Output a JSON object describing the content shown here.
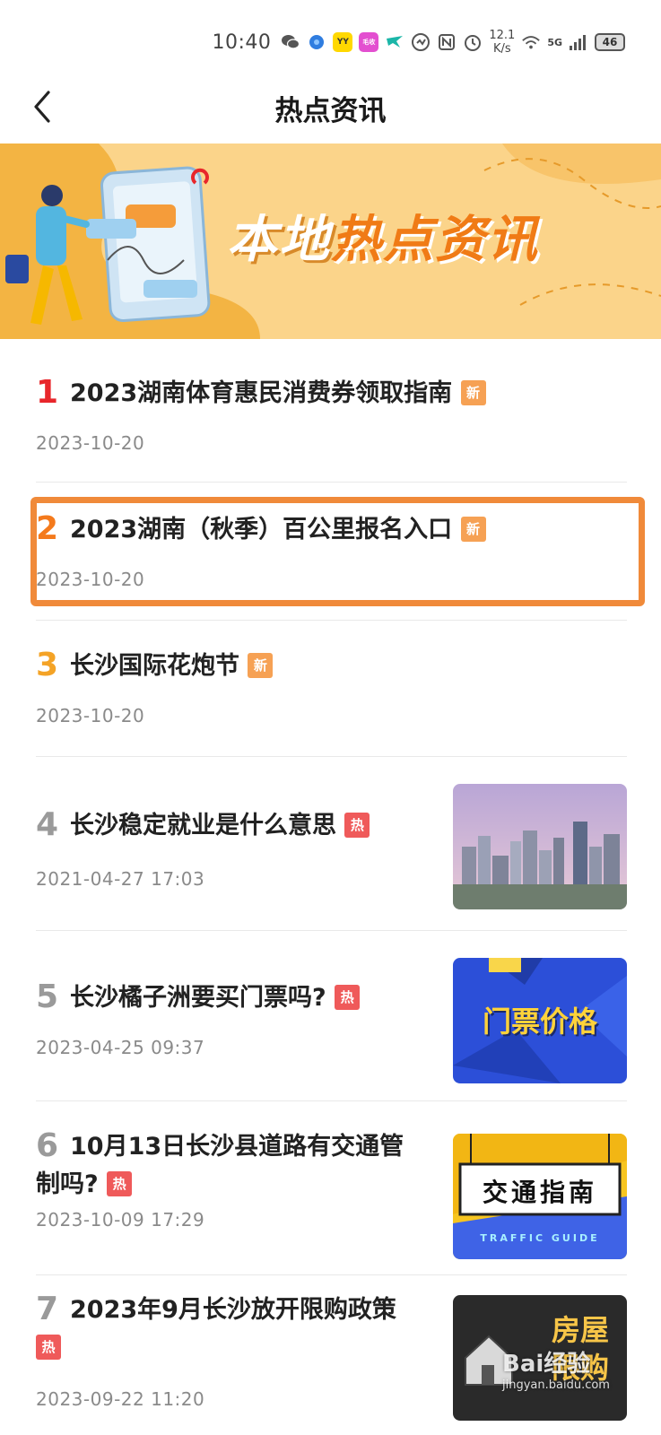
{
  "status_bar": {
    "time": "10:40",
    "icons": [
      "wechat-icon",
      "blue-app-icon",
      "yy-app-icon",
      "pink-app-icon",
      "bird-app-icon",
      "tasks-icon",
      "nfc-icon",
      "alarm-icon"
    ],
    "yy_label": "YY",
    "pink_label": "毛收",
    "speed_value": "12.1",
    "speed_unit": "K/s",
    "network": "5G",
    "battery": "46"
  },
  "header": {
    "title": "热点资讯"
  },
  "banner": {
    "text_white": "本地",
    "text_orange": "热点资讯"
  },
  "news": [
    {
      "rank": "1",
      "title": "2023湖南体育惠民消费券领取指南",
      "badge": "新",
      "date": "2023-10-20"
    },
    {
      "rank": "2",
      "title": "2023湖南（秋季）百公里报名入口",
      "badge": "新",
      "date": "2023-10-20"
    },
    {
      "rank": "3",
      "title": "长沙国际花炮节",
      "badge": "新",
      "date": "2023-10-20"
    },
    {
      "rank": "4",
      "title": "长沙稳定就业是什么意思",
      "badge": "热",
      "date": "2021-04-27 17:03",
      "thumb": "city-skyline-image"
    },
    {
      "rank": "5",
      "title": "长沙橘子洲要买门票吗?",
      "badge": "热",
      "date": "2023-04-25 09:37",
      "thumb": "ticket-price-image",
      "thumb_text": "门票价格"
    },
    {
      "rank": "6",
      "title": "10月13日长沙县道路有交通管制吗?",
      "badge": "热",
      "date": "2023-10-09 17:29",
      "thumb": "traffic-guide-image",
      "thumb_text": "交通指南",
      "thumb_sub": "TRAFFIC GUIDE"
    },
    {
      "rank": "7",
      "title": "2023年9月长沙放开限购政策",
      "badge": "热",
      "date": "2023-09-22 11:20",
      "thumb": "house-purchase-image",
      "thumb_text": "房屋",
      "thumb_text2": "限购"
    }
  ],
  "watermark": {
    "text": "Bai经验",
    "url": "jingyan.baidu.com"
  },
  "colors": {
    "rank1": "#e8262b",
    "rank2": "#f47a1c",
    "rank3": "#f4a326",
    "rank_other": "#9a9a9a",
    "badge_new": "#f6a154",
    "badge_hot": "#ef5a5a",
    "highlight": "#f08a3a",
    "banner_bg": "#fbd48a"
  }
}
